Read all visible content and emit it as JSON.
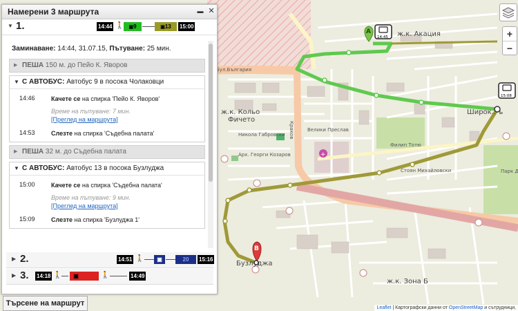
{
  "panel": {
    "title": "Намерени 3 маршрута",
    "minimize_symbol": "▬",
    "close_symbol": "✕"
  },
  "routes": [
    {
      "num": "1.",
      "start_time": "14:44",
      "end_time": "15:00",
      "walk_icon": "walk-icon",
      "bus1": {
        "num": "9",
        "color": "#22bb22"
      },
      "bus2": {
        "num": "13",
        "color": "#9a9a26"
      }
    },
    {
      "num": "2.",
      "start_time": "14:51",
      "end_time": "15:16",
      "bus": {
        "num": "20",
        "color": "#1b2f88"
      }
    },
    {
      "num": "3.",
      "start_time": "14:18",
      "end_time": "14:49",
      "bus": {
        "num": "",
        "color": "#dd2222"
      }
    }
  ],
  "details": {
    "departure_label": "Заминаване:",
    "departure_value": " 14:44, 31.07.15,",
    "duration_label": " Пътуване:",
    "duration_value": " 25 мин.",
    "walk1": {
      "mode": "ПЕША",
      "text": "150 м. до Пейо К. Яворов"
    },
    "bus9": {
      "mode": "С АВТОБУС:",
      "text": "Автобус 9 в посока Чолаковци",
      "board_time": "14:46",
      "board_verb": "Качете се",
      "board_text": " на спирка 'Пейо К. Яворов'",
      "travel_note": "Време на пътуване: 7 мин.",
      "route_link": "[Преглед на маршрута]",
      "alight_time": "14:53",
      "alight_verb": "Слезте",
      "alight_text": " на спирка 'Съдебна палата'"
    },
    "walk2": {
      "mode": "ПЕША",
      "text": "32 м. до Съдебна палата"
    },
    "bus13": {
      "mode": "С АВТОБУС:",
      "text": "Автобус 13 в посока Бузлуджа",
      "board_time": "15:00",
      "board_verb": "Качете се",
      "board_text": " на спирка 'Съдебна палата'",
      "travel_note": "Време на пътуване: 9 мин.",
      "route_link": "[Преглед на маршрута]",
      "alight_time": "15:09",
      "alight_verb": "Слезте",
      "alight_text": " на спирка 'Бузлуджа 1'"
    }
  },
  "search_tab": "Търсене на маршрут",
  "map": {
    "labels": {
      "akatsia": "ж.к. Акация",
      "bulgaria": "Бул.България",
      "kolyo": "ж.к. Кольо",
      "fichetо": "Фичето",
      "shiroko": "Широк.. ъ",
      "buzludzha": "Бузлуджа",
      "zona_b": "ж.к. Зона Б",
      "krakow": "Краков",
      "park": "Парк Д...",
      "arx": "Арх. Георги Козаров",
      "nikola": "Никола Габровски",
      "veliki": "Велики Преслав",
      "filip": "Филип Тотю",
      "stoyan": "Стоян Михайловски"
    },
    "stop_times": {
      "a": "14:45",
      "b": "15:08"
    },
    "marker_a": "A",
    "marker_b": "B",
    "route_colors": {
      "bus9": "#5fc94f",
      "bus13": "#9f9a38"
    }
  },
  "zoom": {
    "in": "+",
    "out": "−"
  },
  "attribution": {
    "leaflet": "Leaflet",
    "text": " | Картографски данни от ",
    "osm": "OpenStreetMap",
    "suffix": " и сътрудници,"
  }
}
